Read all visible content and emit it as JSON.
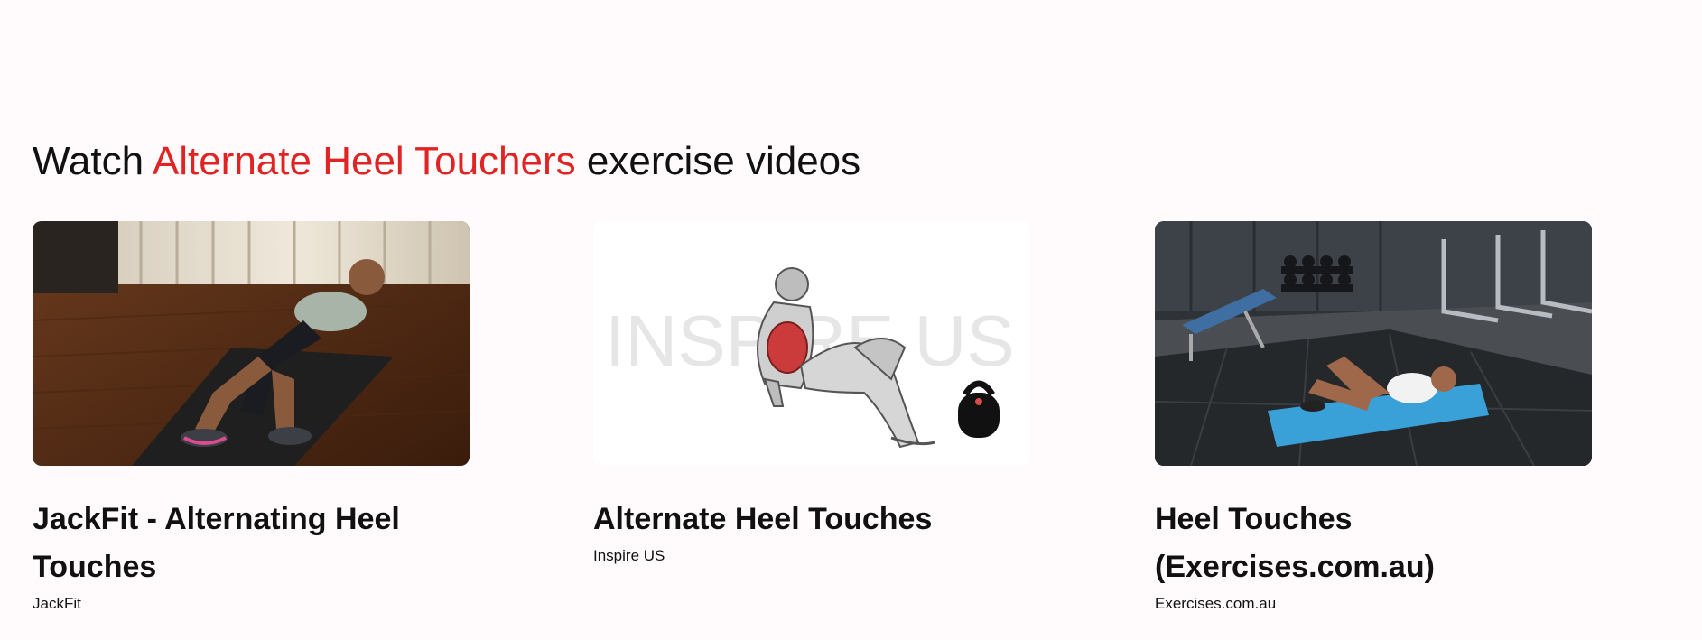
{
  "section": {
    "title_prefix": "Watch",
    "title_highlight": "Alternate Heel Touchers",
    "title_suffix": "exercise videos",
    "accent_color": "#e02424"
  },
  "videos": [
    {
      "title": "JackFit - Alternating Heel Touches",
      "source": "JackFit",
      "thumbnail_icon": "man-on-mat-wood-floor-photo"
    },
    {
      "title": "Alternate Heel Touches",
      "source": "Inspire US",
      "thumbnail_icon": "anatomy-illustration-kettlebell",
      "thumbnail_watermark": "INSPIRE US"
    },
    {
      "title": "Heel Touches (Exercises.com.au)",
      "source": "Exercises.com.au",
      "thumbnail_icon": "gym-floor-blue-mat-photo"
    }
  ]
}
